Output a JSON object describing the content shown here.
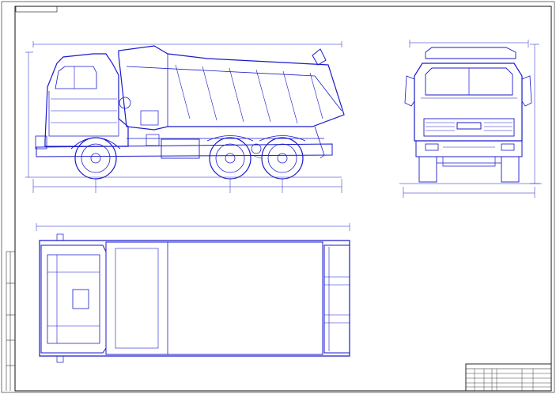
{
  "colors": {
    "drawing": "#1a1acc",
    "frame": "#111111",
    "text": "#1a1a8c",
    "background": "#ffffff"
  },
  "stamp_top": "",
  "dimensions": {
    "overall_length": "",
    "overall_height": "",
    "span_front": "",
    "span_middle": "",
    "span_rear": "",
    "front_height": "",
    "front_width": ""
  },
  "specs": {
    "title": "",
    "rows": [
      {
        "label": "",
        "value": ""
      },
      {
        "label": "",
        "value": ""
      },
      {
        "label": "",
        "value": ""
      },
      {
        "label": "",
        "value": ""
      },
      {
        "label": "",
        "value": ""
      },
      {
        "label": "",
        "value": ""
      },
      {
        "label": "",
        "value": ""
      },
      {
        "label": "",
        "value": ""
      },
      {
        "label": "",
        "value": ""
      },
      {
        "label": "",
        "value": ""
      },
      {
        "label": "",
        "value": ""
      },
      {
        "label": "",
        "value": ""
      },
      {
        "label": "",
        "value": ""
      },
      {
        "label": "",
        "value": ""
      },
      {
        "label": "",
        "value": ""
      },
      {
        "label": "",
        "value": ""
      },
      {
        "label": "",
        "value": ""
      },
      {
        "label": "",
        "value": ""
      },
      {
        "label": "",
        "value": ""
      },
      {
        "label": "",
        "value": ""
      },
      {
        "label": "",
        "value": ""
      },
      {
        "label": "",
        "value": ""
      },
      {
        "label": "",
        "value": ""
      },
      {
        "label": "",
        "value": ""
      }
    ]
  },
  "title_block": {
    "document_code": "",
    "name_line1": "",
    "name_line2": "",
    "scale": "",
    "sheet": ""
  },
  "grille_badge": ""
}
